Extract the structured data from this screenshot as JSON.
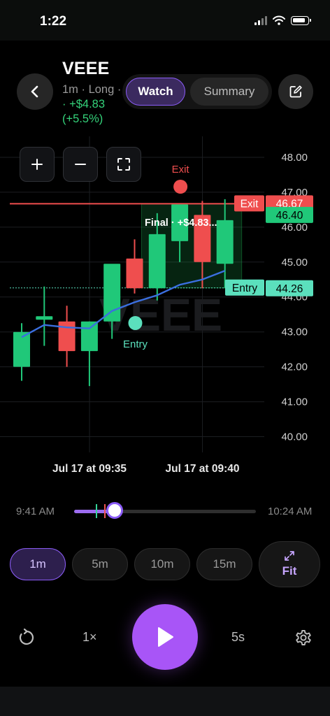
{
  "status_bar": {
    "time": "1:22"
  },
  "header": {
    "ticker": "VEEE",
    "subinfo": "1m · Long · 2",
    "gain_amount": "· +$4.83",
    "gain_percent": "(+5.5%)",
    "tabs": [
      {
        "label": "Watch",
        "active": true
      },
      {
        "label": "Summary",
        "active": false
      }
    ]
  },
  "chart_data": {
    "type": "candlestick",
    "watermark": "VEEE",
    "y_ticks": [
      48.0,
      47.0,
      46.0,
      45.0,
      44.0,
      43.0,
      42.0,
      41.0,
      40.0
    ],
    "y_tick_labels": [
      "48.00",
      "47.00",
      "46.00",
      "45.00",
      "44.00",
      "43.00",
      "42.00",
      "41.00",
      "40.00"
    ],
    "ylim": [
      39.55,
      48.6
    ],
    "x_labels": [
      {
        "label": "Jul 17 at 09:35",
        "index": 3.5
      },
      {
        "label": "Jul 17 at 09:40",
        "index": 8.5
      }
    ],
    "candles": [
      {
        "o": 42.0,
        "h": 43.25,
        "l": 41.6,
        "c": 43.0
      },
      {
        "o": 43.35,
        "h": 44.3,
        "l": 42.6,
        "c": 43.45
      },
      {
        "o": 43.3,
        "h": 43.75,
        "l": 42.0,
        "c": 42.45
      },
      {
        "o": 42.45,
        "h": 43.3,
        "l": 41.45,
        "c": 43.3
      },
      {
        "o": 43.3,
        "h": 44.35,
        "l": 42.8,
        "c": 44.95
      },
      {
        "o": 45.1,
        "h": 45.65,
        "l": 44.1,
        "c": 44.25
      },
      {
        "o": 44.25,
        "h": 46.4,
        "l": 43.9,
        "c": 45.8
      },
      {
        "o": 45.6,
        "h": 46.6,
        "l": 45.0,
        "c": 46.65
      },
      {
        "o": 46.35,
        "h": 46.75,
        "l": 44.25,
        "c": 45.0
      },
      {
        "o": 44.95,
        "h": 46.8,
        "l": 44.25,
        "c": 46.2
      }
    ],
    "moving_average": [
      42.85,
      43.2,
      43.13,
      43.1,
      43.6,
      43.85,
      44.05,
      44.35,
      44.5,
      44.75
    ],
    "entry_price": 44.26,
    "exit_price": 46.67,
    "last_price": 46.4,
    "entry_label": "Entry",
    "exit_label": "Exit",
    "entry_tag": "44.26",
    "exit_tag": "46.67",
    "last_tag": "46.40",
    "entry_marker_index": 5,
    "exit_marker_index": 7,
    "trade_span": [
      5,
      9
    ],
    "final_label": "Final · +$4.83...",
    "colors": {
      "up": "#20c879",
      "down": "#ef4e4e",
      "ma": "#3b6fe0",
      "entry": "#5be0bd",
      "exit": "#ef4e4e",
      "grid": "#1c1e22"
    }
  },
  "timeline": {
    "start": "9:41 AM",
    "end": "10:24 AM",
    "progress": 0.22
  },
  "intervals": [
    {
      "label": "1m",
      "active": true
    },
    {
      "label": "5m",
      "active": false
    },
    {
      "label": "10m",
      "active": false
    },
    {
      "label": "15m",
      "active": false
    }
  ],
  "fit_label": "Fit",
  "playback": {
    "speed": "1×",
    "step": "5s"
  }
}
